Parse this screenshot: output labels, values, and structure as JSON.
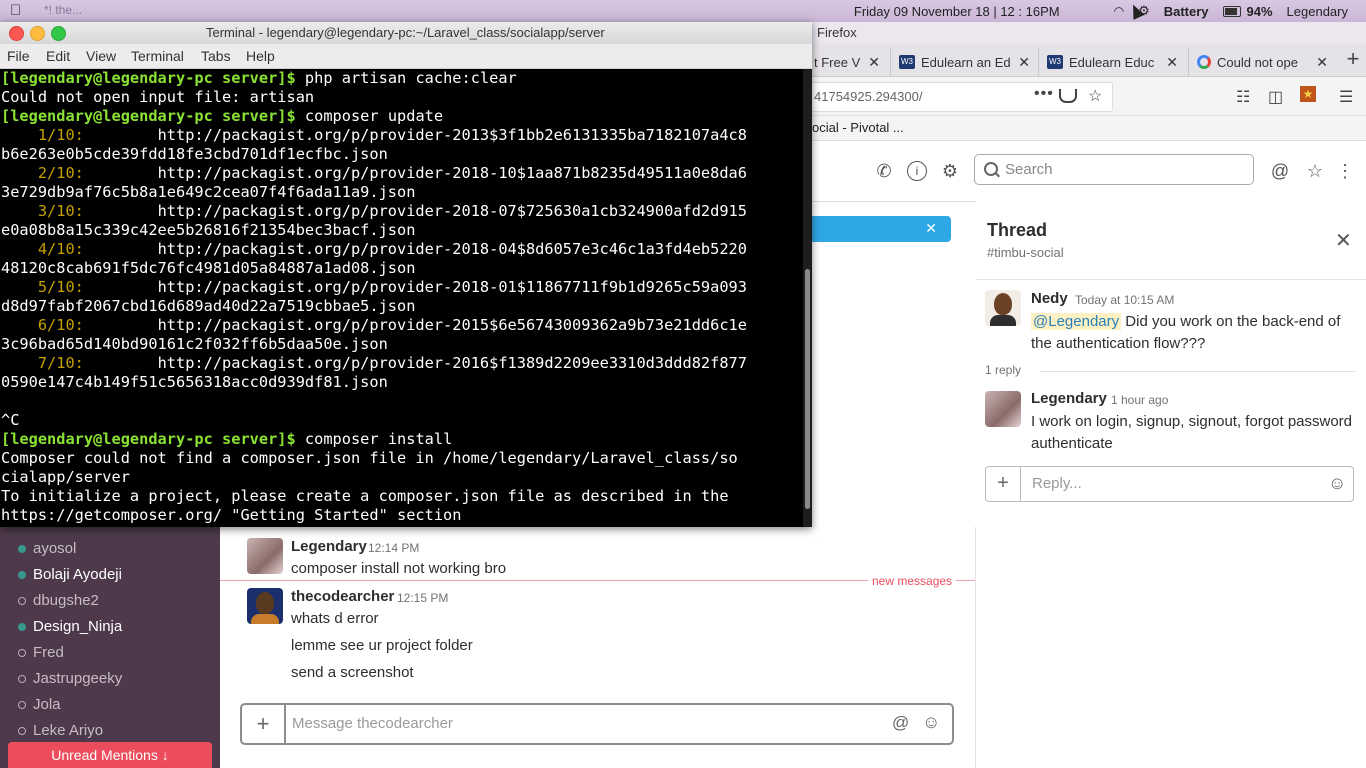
{
  "menubar": {
    "ghost_title": "*! the...",
    "datetime": "Friday 09 November 18 | 12 : 16PM",
    "battery_label": "Battery",
    "battery_pct": "94%",
    "user": "Legendary"
  },
  "terminal": {
    "title": "Terminal - legendary@legendary-pc:~/Laravel_class/socialapp/server",
    "menu": [
      "File",
      "Edit",
      "View",
      "Terminal",
      "Tabs",
      "Help"
    ],
    "lines": [
      {
        "prompt": "[legendary@legendary-pc server]$",
        "text": " php artisan cache:clear"
      },
      {
        "text": "Could not open input file: artisan"
      },
      {
        "prompt": "[legendary@legendary-pc server]$",
        "text": " composer update"
      },
      {
        "prog": "    1/10:",
        "text": "        http://packagist.org/p/provider-2013$3f1bb2e6131335ba7182107a4c8"
      },
      {
        "text": "b6e263e0b5cde39fdd18fe3cbd701df1ecfbc.json"
      },
      {
        "prog": "    2/10:",
        "text": "        http://packagist.org/p/provider-2018-10$1aa871b8235d49511a0e8da6"
      },
      {
        "text": "3e729db9af76c5b8a1e649c2cea07f4f6ada11a9.json"
      },
      {
        "prog": "    3/10:",
        "text": "        http://packagist.org/p/provider-2018-07$725630a1cb324900afd2d915"
      },
      {
        "text": "e0a08b8a15c339c42ee5b26816f21354bec3bacf.json"
      },
      {
        "prog": "    4/10:",
        "text": "        http://packagist.org/p/provider-2018-04$8d6057e3c46c1a3fd4eb5220"
      },
      {
        "text": "48120c8cab691f5dc76fc4981d05a84887a1ad08.json"
      },
      {
        "prog": "    5/10:",
        "text": "        http://packagist.org/p/provider-2018-01$11867711f9b1d9265c59a093"
      },
      {
        "text": "d8d97fabf2067cbd16d689ad40d22a7519cbbae5.json"
      },
      {
        "prog": "    6/10:",
        "text": "        http://packagist.org/p/provider-2015$6e56743009362a9b73e21dd6c1e"
      },
      {
        "text": "3c96bad65d140bd90161c2f032ff6b5daa50e.json"
      },
      {
        "prog": "    7/10:",
        "text": "        http://packagist.org/p/provider-2016$f1389d2209ee3310d3ddd82f877"
      },
      {
        "text": "0590e147c4b149f51c5656318acc0d939df81.json"
      },
      {
        "text": ""
      },
      {
        "text": "^C"
      },
      {
        "prompt": "[legendary@legendary-pc server]$",
        "text": " composer install"
      },
      {
        "text": "Composer could not find a composer.json file in /home/legendary/Laravel_class/so"
      },
      {
        "text": "cialapp/server"
      },
      {
        "text": "To initialize a project, please create a composer.json file as described in the"
      },
      {
        "text": "https://getcomposer.org/ \"Getting Started\" section"
      }
    ]
  },
  "firefox": {
    "app_name": "Firefox",
    "tabs": [
      {
        "label": "t Free V"
      },
      {
        "label": "Edulearn an Ed",
        "fav": "W3"
      },
      {
        "label": "Edulearn Educ",
        "fav": "W3"
      },
      {
        "label": "Could not ope"
      }
    ],
    "url": "41754925.294300/",
    "bookmark": "ocial - Pivotal ..."
  },
  "slack": {
    "search_placeholder": "Search",
    "channels": [
      {
        "name": "ayosol",
        "online": true
      },
      {
        "name": "Bolaji Ayodeji",
        "online": true,
        "bright": true
      },
      {
        "name": "dbugshe2",
        "online": false
      },
      {
        "name": "Design_Ninja",
        "online": true,
        "bright": true
      },
      {
        "name": "Fred",
        "online": false
      },
      {
        "name": "Jastrupgeeky",
        "online": false
      },
      {
        "name": "Jola",
        "online": false
      },
      {
        "name": "Leke Ariyo",
        "online": false
      }
    ],
    "unread_label": "Unread Mentions",
    "messages": {
      "m1": {
        "user": "Legendary",
        "time": "12:14 PM",
        "text": "composer install not working bro"
      },
      "m2": {
        "user": "thecodearcher",
        "time": "12:15 PM",
        "lines": [
          "whats d error",
          "lemme see ur project folder",
          "send a screenshot"
        ]
      }
    },
    "new_messages": "new messages",
    "composer_placeholder": "Message thecodearcher",
    "thread": {
      "title": "Thread",
      "channel": "#timbu-social",
      "parent": {
        "user": "Nedy",
        "time": "Today at 10:15 AM",
        "mention": "@Legendary",
        "text": " Did you work on the back-end of the authentication flow???"
      },
      "reply_count": "1 reply",
      "reply": {
        "user": "Legendary",
        "time": "1 hour ago",
        "text": "I work on login, signup, signout, forgot password authenticate"
      },
      "reply_placeholder": "Reply..."
    }
  }
}
